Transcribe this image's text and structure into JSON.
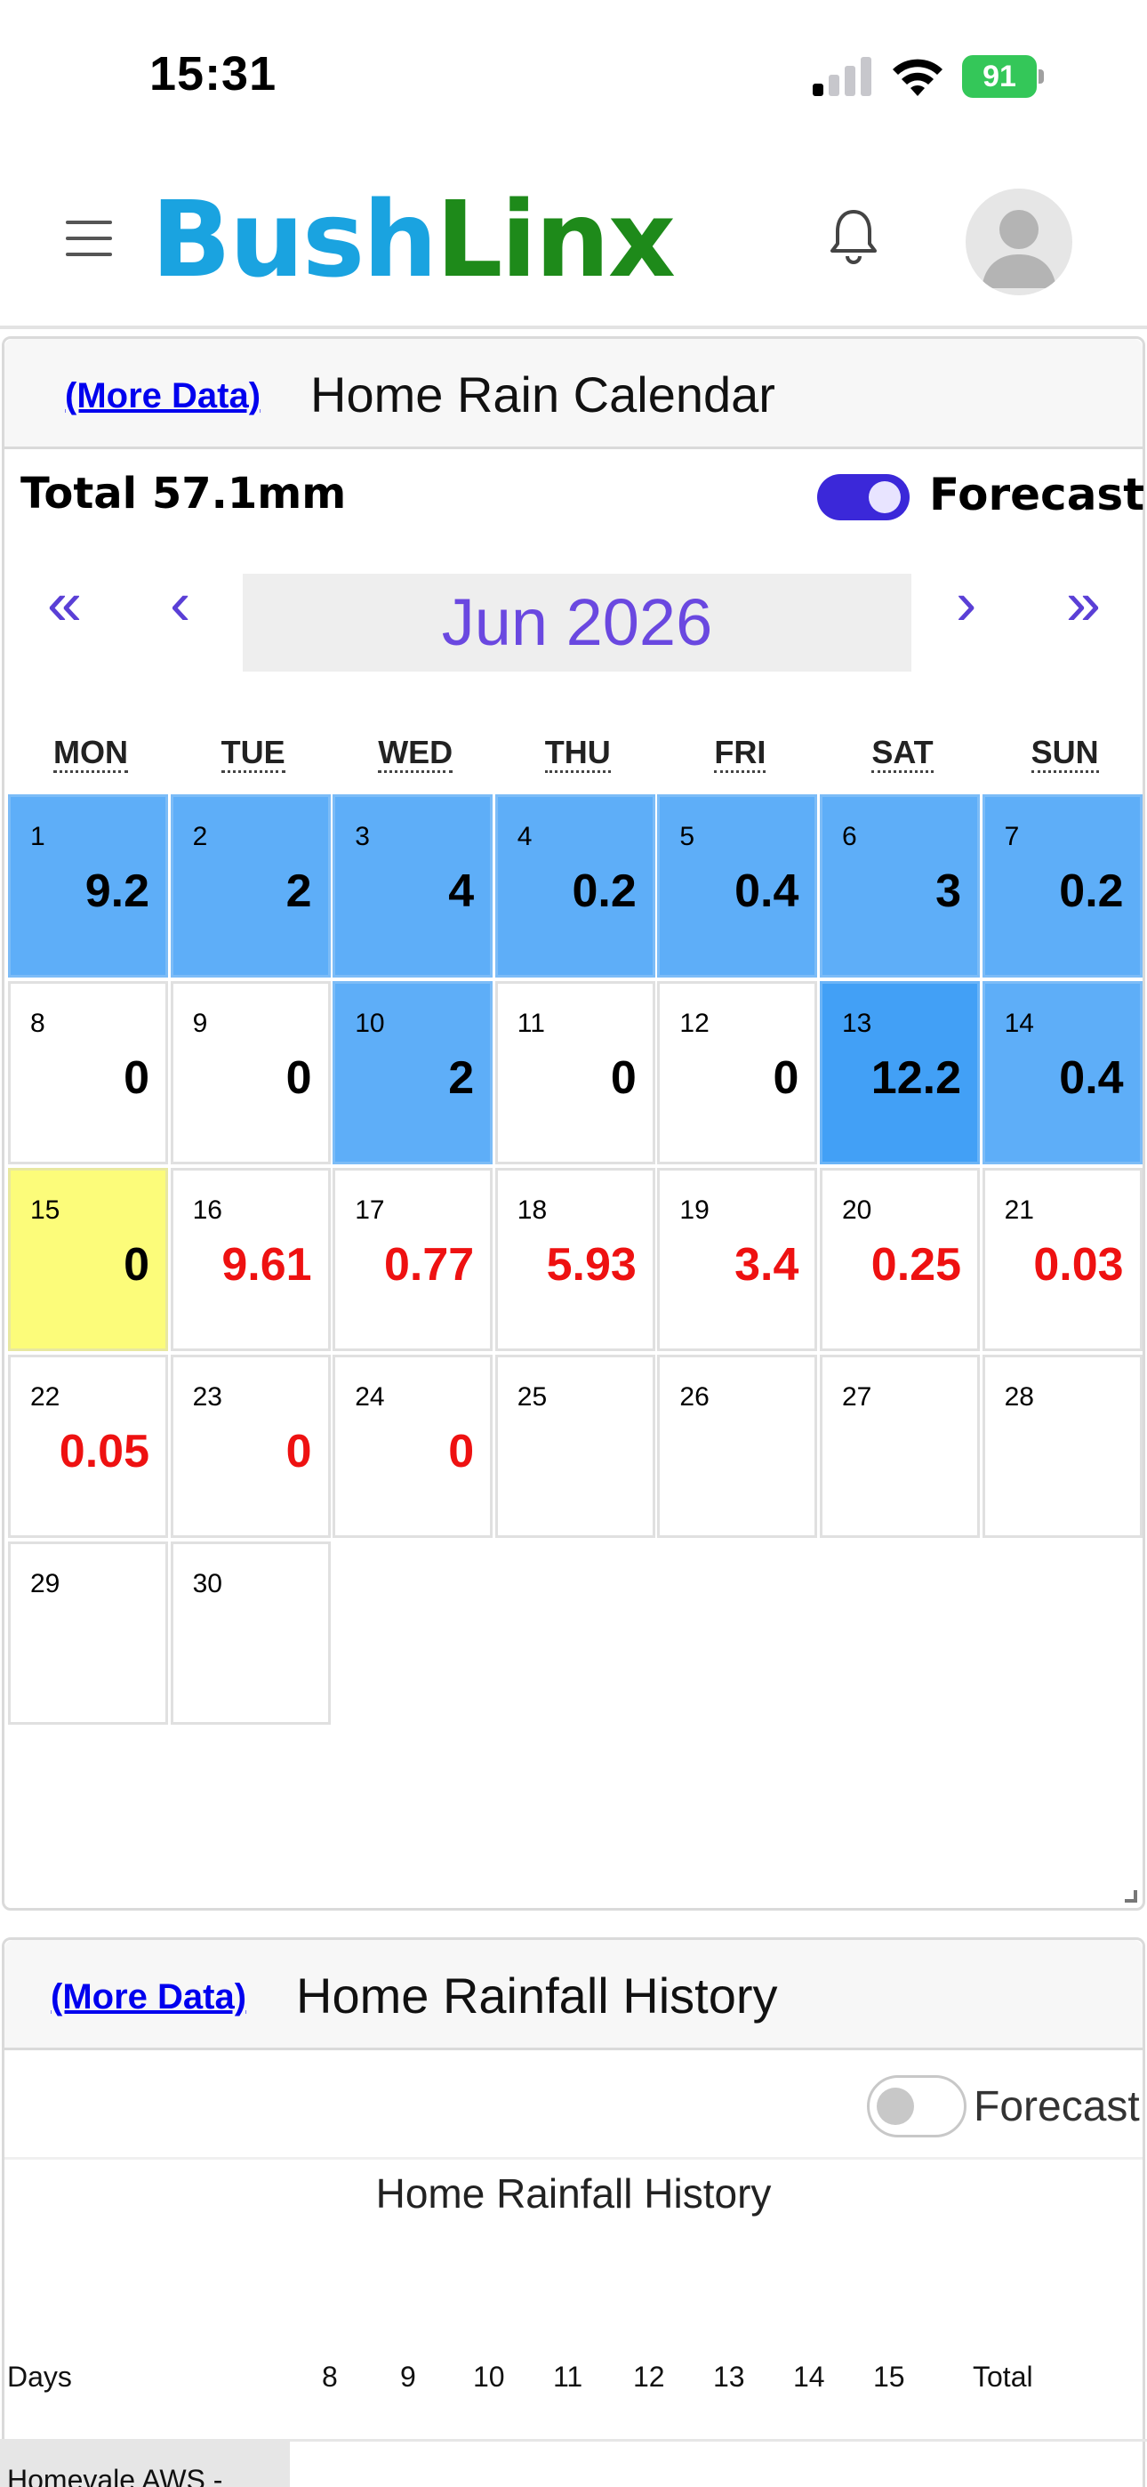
{
  "status_bar": {
    "time": "15:31",
    "battery": "91"
  },
  "header": {
    "logo_part1": "Bush",
    "logo_part2": "Linx"
  },
  "calendar_card": {
    "more_link": "(More Data)",
    "title": "Home Rain Calendar",
    "total": "Total 57.1mm",
    "forecast_label": "Forecast",
    "forecast_on": true,
    "nav": {
      "first": "«",
      "prev": "‹",
      "next": "›",
      "last": "»"
    },
    "month": "Jun 2026",
    "weekdays": [
      "MON",
      "TUE",
      "WED",
      "THU",
      "FRI",
      "SAT",
      "SUN"
    ],
    "days": [
      {
        "d": "1",
        "v": "9.2",
        "kind": "blue"
      },
      {
        "d": "2",
        "v": "2",
        "kind": "blue"
      },
      {
        "d": "3",
        "v": "4",
        "kind": "blue"
      },
      {
        "d": "4",
        "v": "0.2",
        "kind": "blue"
      },
      {
        "d": "5",
        "v": "0.4",
        "kind": "blue"
      },
      {
        "d": "6",
        "v": "3",
        "kind": "blue"
      },
      {
        "d": "7",
        "v": "0.2",
        "kind": "blue"
      },
      {
        "d": "8",
        "v": "0",
        "kind": "white"
      },
      {
        "d": "9",
        "v": "0",
        "kind": "white"
      },
      {
        "d": "10",
        "v": "2",
        "kind": "blue"
      },
      {
        "d": "11",
        "v": "0",
        "kind": "white"
      },
      {
        "d": "12",
        "v": "0",
        "kind": "white"
      },
      {
        "d": "13",
        "v": "12.2",
        "kind": "dark"
      },
      {
        "d": "14",
        "v": "0.4",
        "kind": "blue"
      },
      {
        "d": "15",
        "v": "0",
        "kind": "today"
      },
      {
        "d": "16",
        "v": "9.61",
        "kind": "forecast"
      },
      {
        "d": "17",
        "v": "0.77",
        "kind": "forecast"
      },
      {
        "d": "18",
        "v": "5.93",
        "kind": "forecast"
      },
      {
        "d": "19",
        "v": "3.4",
        "kind": "forecast"
      },
      {
        "d": "20",
        "v": "0.25",
        "kind": "forecast"
      },
      {
        "d": "21",
        "v": "0.03",
        "kind": "forecast"
      },
      {
        "d": "22",
        "v": "0.05",
        "kind": "forecast"
      },
      {
        "d": "23",
        "v": "0",
        "kind": "forecast"
      },
      {
        "d": "24",
        "v": "0",
        "kind": "forecast"
      },
      {
        "d": "25",
        "v": "",
        "kind": "white"
      },
      {
        "d": "26",
        "v": "",
        "kind": "white"
      },
      {
        "d": "27",
        "v": "",
        "kind": "white"
      },
      {
        "d": "28",
        "v": "",
        "kind": "white"
      },
      {
        "d": "29",
        "v": "",
        "kind": "white"
      },
      {
        "d": "30",
        "v": "",
        "kind": "white"
      }
    ]
  },
  "history_card": {
    "more_link": "(More Data)",
    "title": "Home Rainfall History",
    "forecast_label": "Forecast",
    "forecast_on": false,
    "table_title": "Home Rainfall History",
    "days_label": "Days",
    "columns": [
      "8",
      "9",
      "10",
      "11",
      "12",
      "13",
      "14",
      "15",
      "Total"
    ],
    "first_row_label": "Homevale AWS -"
  }
}
